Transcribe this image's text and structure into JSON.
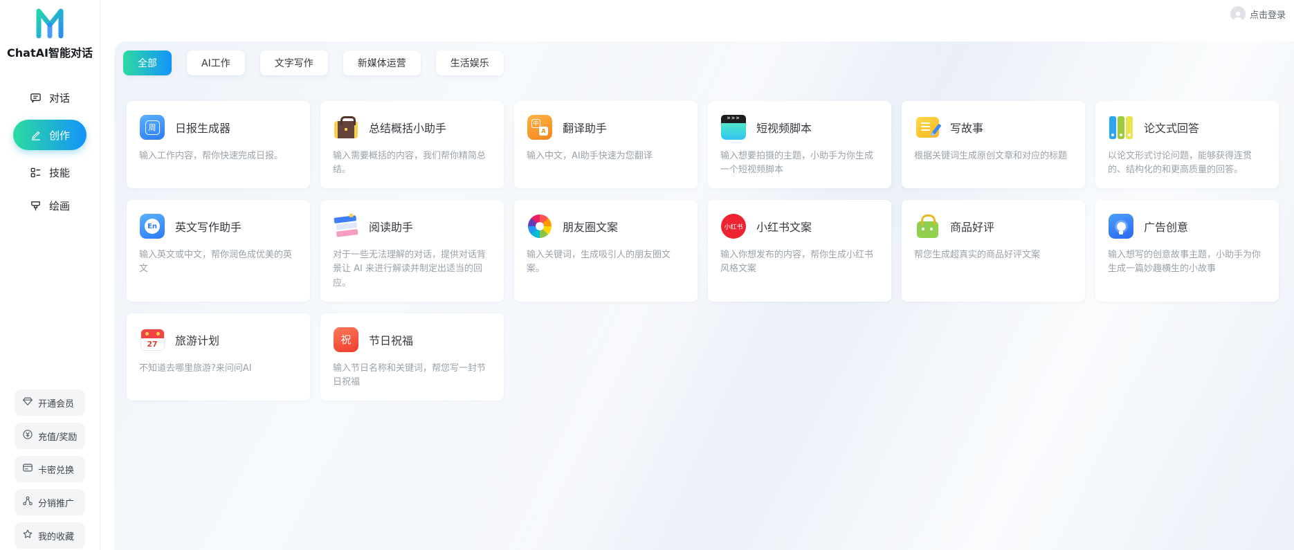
{
  "brand": {
    "title": "ChatAI智能对话",
    "logo_letter": "M"
  },
  "header": {
    "login_label": "点击登录"
  },
  "colors": {
    "accent_start": "#2bdb9f",
    "accent_end": "#1493fb",
    "panel_bg": "#eef2f9",
    "xiaohongshu_red": "#ee2230"
  },
  "sidebar": {
    "nav": [
      {
        "label": "对话",
        "icon": "chat-bubble-icon",
        "active": false
      },
      {
        "label": "创作",
        "icon": "pencil-icon",
        "active": true
      },
      {
        "label": "技能",
        "icon": "skills-grid-icon",
        "active": false
      },
      {
        "label": "绘画",
        "icon": "paint-brush-icon",
        "active": false
      }
    ],
    "actions": [
      {
        "label": "开通会员",
        "icon": "gem-icon"
      },
      {
        "label": "充值/奖励",
        "icon": "coin-yen-icon"
      },
      {
        "label": "卡密兑换",
        "icon": "card-icon"
      },
      {
        "label": "分销推广",
        "icon": "share-network-icon"
      },
      {
        "label": "我的收藏",
        "icon": "star-icon"
      }
    ]
  },
  "tabs": [
    {
      "label": "全部",
      "active": true
    },
    {
      "label": "AI工作",
      "active": false
    },
    {
      "label": "文字写作",
      "active": false
    },
    {
      "label": "新媒体运营",
      "active": false
    },
    {
      "label": "生活娱乐",
      "active": false
    }
  ],
  "cards": [
    {
      "title": "日报生成器",
      "desc": "输入工作内容，帮你快速完成日报。",
      "icon": "daily-report-icon"
    },
    {
      "title": "总结概括小助手",
      "desc": "输入需要概括的内容，我们帮你精简总结。",
      "icon": "briefcase-icon"
    },
    {
      "title": "翻译助手",
      "desc": "输入中文，AI助手快速为您翻译",
      "icon": "translate-icon"
    },
    {
      "title": "短视频脚本",
      "desc": "输入想要拍摄的主题，小助手为你生成一个短视频脚本",
      "icon": "clapperboard-icon"
    },
    {
      "title": "写故事",
      "desc": "根据关键词生成原创文章和对应的标题",
      "icon": "story-note-icon"
    },
    {
      "title": "论文式回答",
      "desc": "以论文形式讨论问题，能够获得连贯的、结构化的和更高质量的回答。",
      "icon": "binders-icon"
    },
    {
      "title": "英文写作助手",
      "desc": "输入英文或中文，帮你润色成优美的英文",
      "icon": "english-writing-icon"
    },
    {
      "title": "阅读助手",
      "desc": "对于一些无法理解的对话，提供对话背景让 AI 来进行解读并制定出适当的回应。",
      "icon": "books-icon"
    },
    {
      "title": "朋友圈文案",
      "desc": "输入关键词，生成吸引人的朋友圈文案。",
      "icon": "moments-pinwheel-icon"
    },
    {
      "title": "小红书文案",
      "desc": "输入你想发布的内容，帮你生成小红书风格文案",
      "icon": "xiaohongshu-icon"
    },
    {
      "title": "商品好评",
      "desc": "帮您生成超真实的商品好评文案",
      "icon": "shopping-bag-icon"
    },
    {
      "title": "广告创意",
      "desc": "输入想写的创意故事主题，小助手为你生成一篇妙趣横生的小故事",
      "icon": "idea-bulb-icon"
    },
    {
      "title": "旅游计划",
      "desc": "不知道去哪里旅游?来问问AI",
      "icon": "travel-calendar-icon"
    },
    {
      "title": "节日祝福",
      "desc": "输入节日名称和关键词，帮您写一封节日祝福",
      "icon": "festival-icon"
    }
  ]
}
